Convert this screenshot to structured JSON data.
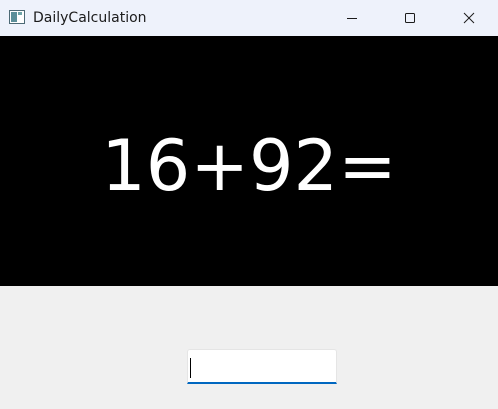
{
  "window": {
    "title": "DailyCalculation",
    "controls": {
      "minimize_icon": "minimize-icon",
      "maximize_icon": "maximize-icon",
      "close_icon": "close-icon"
    }
  },
  "display": {
    "expression": "16+92=",
    "background_color": "#000000",
    "text_color": "#ffffff"
  },
  "answer": {
    "value": "",
    "placeholder": "",
    "accent_color": "#0067c0"
  }
}
